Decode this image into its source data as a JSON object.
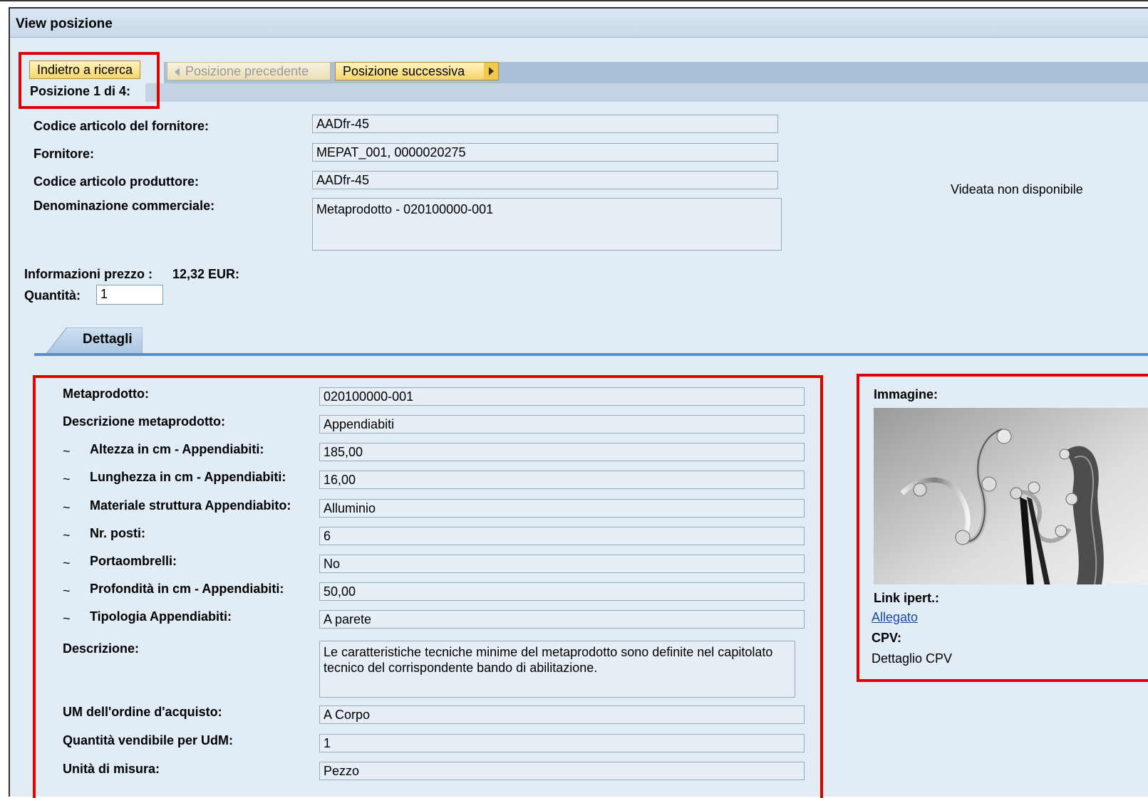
{
  "window": {
    "title": "View posizione"
  },
  "toolbar": {
    "back_label": "Indietro a ricerca",
    "prev_label": "Posizione precedente",
    "next_label": "Posizione successiva",
    "position_label": "Posizione 1 di 4:"
  },
  "header_fields": [
    {
      "label": "Codice articolo del fornitore:",
      "value": "AADfr-45"
    },
    {
      "label": "Fornitore:",
      "value": "MEPAT_001, 0000020275"
    },
    {
      "label": "Codice articolo produttore:",
      "value": "AADfr-45"
    },
    {
      "label": "Denominazione commerciale:",
      "value": "Metaprodotto - 020100000-001"
    }
  ],
  "screen_unavailable": "Videata non disponibile",
  "price": {
    "label": "Informazioni prezzo :",
    "value": "12,32 EUR:"
  },
  "quantity": {
    "label": "Quantità:",
    "value": "1"
  },
  "tabs": [
    {
      "label": "Dettagli"
    }
  ],
  "details": [
    {
      "label": "Metaprodotto:",
      "value": "020100000-001",
      "tilde": ""
    },
    {
      "label": "Descrizione metaprodotto:",
      "value": "Appendiabiti",
      "tilde": ""
    },
    {
      "label": "Altezza in cm - Appendiabiti:",
      "value": "185,00",
      "tilde": "~"
    },
    {
      "label": "Lunghezza in cm - Appendiabiti:",
      "value": "16,00",
      "tilde": "~"
    },
    {
      "label": "Materiale struttura Appendiabito:",
      "value": "Alluminio",
      "tilde": "~"
    },
    {
      "label": "Nr. posti:",
      "value": "6",
      "tilde": "~"
    },
    {
      "label": "Portaombrelli:",
      "value": "No",
      "tilde": "~"
    },
    {
      "label": "Profondità in cm - Appendiabiti:",
      "value": "50,00",
      "tilde": "~"
    },
    {
      "label": "Tipologia Appendiabiti:",
      "value": "A parete",
      "tilde": "~"
    }
  ],
  "description": {
    "label": "Descrizione:",
    "value": "Le caratteristiche tecniche minime del metaprodotto sono definite nel capitolato tecnico del corrispondente bando di abilitazione."
  },
  "details_bottom": [
    {
      "label": "UM dell'ordine d'acquisto:",
      "value": "A Corpo"
    },
    {
      "label": "Quantità vendibile per UdM:",
      "value": "1"
    },
    {
      "label": "Unità di misura:",
      "value": "Pezzo"
    }
  ],
  "side_panel": {
    "image_label": "Immagine:",
    "link_label": "Link ipert.:",
    "link_text": "Allegato",
    "cpv_label": "CPV:",
    "cpv_text": "Dettaglio CPV"
  },
  "colors": {
    "highlight": "#e00000",
    "background": "#e1ecf5",
    "tab_accent": "#5f8ec0",
    "button": "#f6d66a"
  }
}
